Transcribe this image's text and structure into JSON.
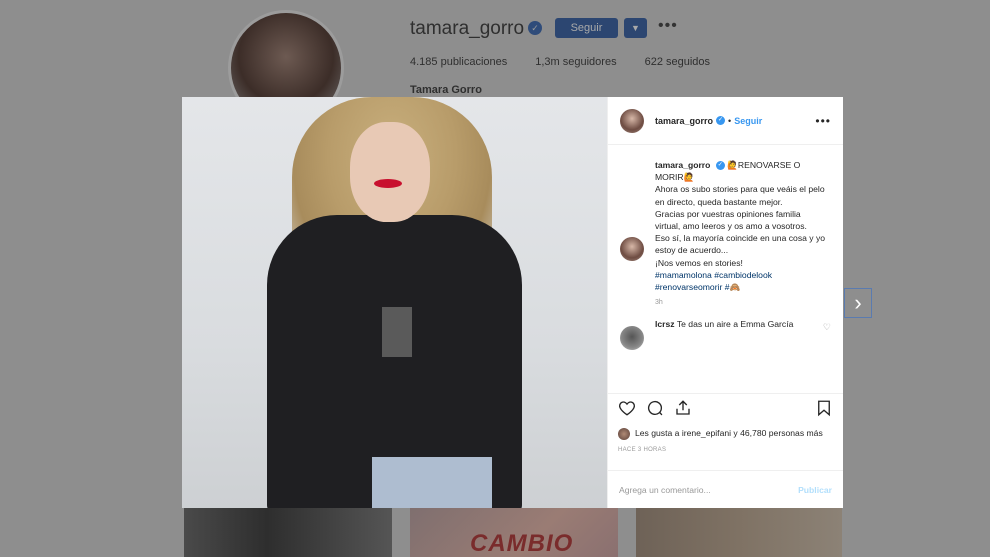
{
  "profile": {
    "username": "tamara_gorro",
    "follow_label": "Seguir",
    "dropdown_icon": "caret-down-icon",
    "more_icon": "more-icon",
    "stats": {
      "posts": "4.185 publicaciones",
      "followers": "1,3m seguidores",
      "following": "622 seguidos"
    },
    "full_name": "Tamara Gorro"
  },
  "background_thumb_text": "CAMBIO",
  "next_arrow": "›",
  "post": {
    "header": {
      "username": "tamara_gorro",
      "separator": "•",
      "follow_label": "Seguir",
      "more": "•••"
    },
    "caption": {
      "username": "tamara_gorro",
      "lines": [
        "🙋RENOVARSE O MORIR🙋",
        "Ahora os subo stories para que veáis el pelo en directo, queda bastante mejor.",
        "Gracias por vuestras opiniones familia virtual, amo leeros y os amo a vosotros.",
        "Eso sí, la mayoría coincide en una cosa y yo estoy de acuerdo...",
        "¡Nos vemos en stories!"
      ],
      "hashtags": "#mamamolona #cambiodelook #renovarseomorir #🙈",
      "time": "3h"
    },
    "comment": {
      "username": "lcrsz",
      "text": "Te das un aire a Emma García"
    },
    "likes_text": "Les gusta a irene_epifani y 46,780 personas más",
    "ago": "HACE 3 HORAS",
    "add_comment_placeholder": "Agrega un comentario...",
    "publish_label": "Publicar"
  }
}
